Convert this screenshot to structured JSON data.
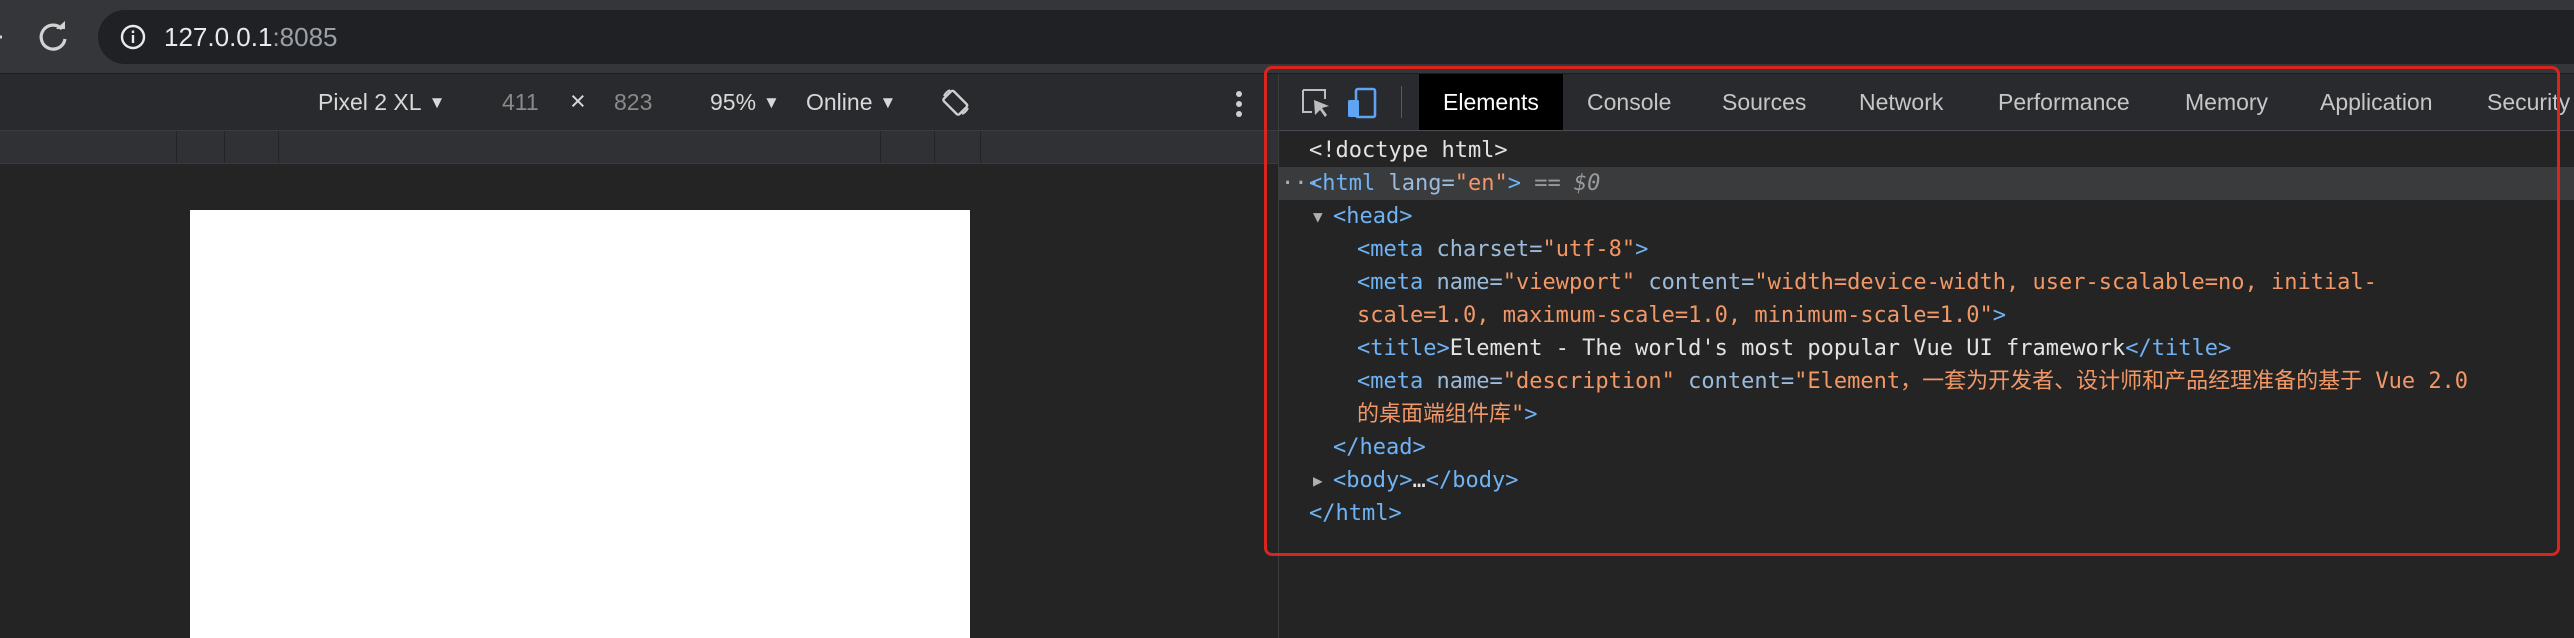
{
  "browser": {
    "url_host": "127.0.0.1",
    "url_port": ":8085"
  },
  "device_toolbar": {
    "device": "Pixel 2 XL",
    "width": "411",
    "times": "×",
    "height": "823",
    "zoom": "95%",
    "network": "Online"
  },
  "devtools": {
    "tabs": [
      "Elements",
      "Console",
      "Sources",
      "Network",
      "Performance",
      "Memory",
      "Application",
      "Security"
    ],
    "active_tab": "Elements"
  },
  "dom": {
    "doctype": "<!doctype html>",
    "html_open": "<html",
    "html_attr": " lang=",
    "html_lang": "\"en\"",
    "html_close_bracket": ">",
    "selected_marker": " == $0",
    "ellipsis": "…",
    "head_open": "<head>",
    "meta1_tag": "<meta",
    "meta1_attr": " charset=",
    "meta1_val": "\"utf-8\"",
    "meta2_tag": "<meta",
    "meta2_attr1": " name=",
    "meta2_val1": "\"viewport\"",
    "meta2_attr2": " content=",
    "meta2_val2_line1": "\"width=device-width, user-scalable=no, initial-",
    "meta2_val2_line2": "scale=1.0, maximum-scale=1.0, minimum-scale=1.0\"",
    "title_open": "<title>",
    "title_text": "Element - The world's most popular Vue UI framework",
    "title_close": "</title>",
    "meta3_tag": "<meta",
    "meta3_attr1": " name=",
    "meta3_val1": "\"description\"",
    "meta3_attr2": " content=",
    "meta3_val2_line1": "\"Element，一套为开发者、设计师和产品经理准备的基于 Vue 2.0",
    "meta3_val2_line2": "的桌面端组件库\"",
    "head_close": "</head>",
    "body_open": "<body>",
    "body_ellipsis": "…",
    "body_close": "</body>",
    "html_end": "</html>",
    "bracket": ">"
  },
  "colors": {
    "highlight_frame": "#d9251d",
    "tag": "#6fb3f5",
    "attribute_value": "#f29766"
  },
  "icons": [
    "reload-icon",
    "info-icon",
    "rotate-icon",
    "more-vert-icon",
    "inspect-element-icon",
    "device-toggle-icon"
  ]
}
